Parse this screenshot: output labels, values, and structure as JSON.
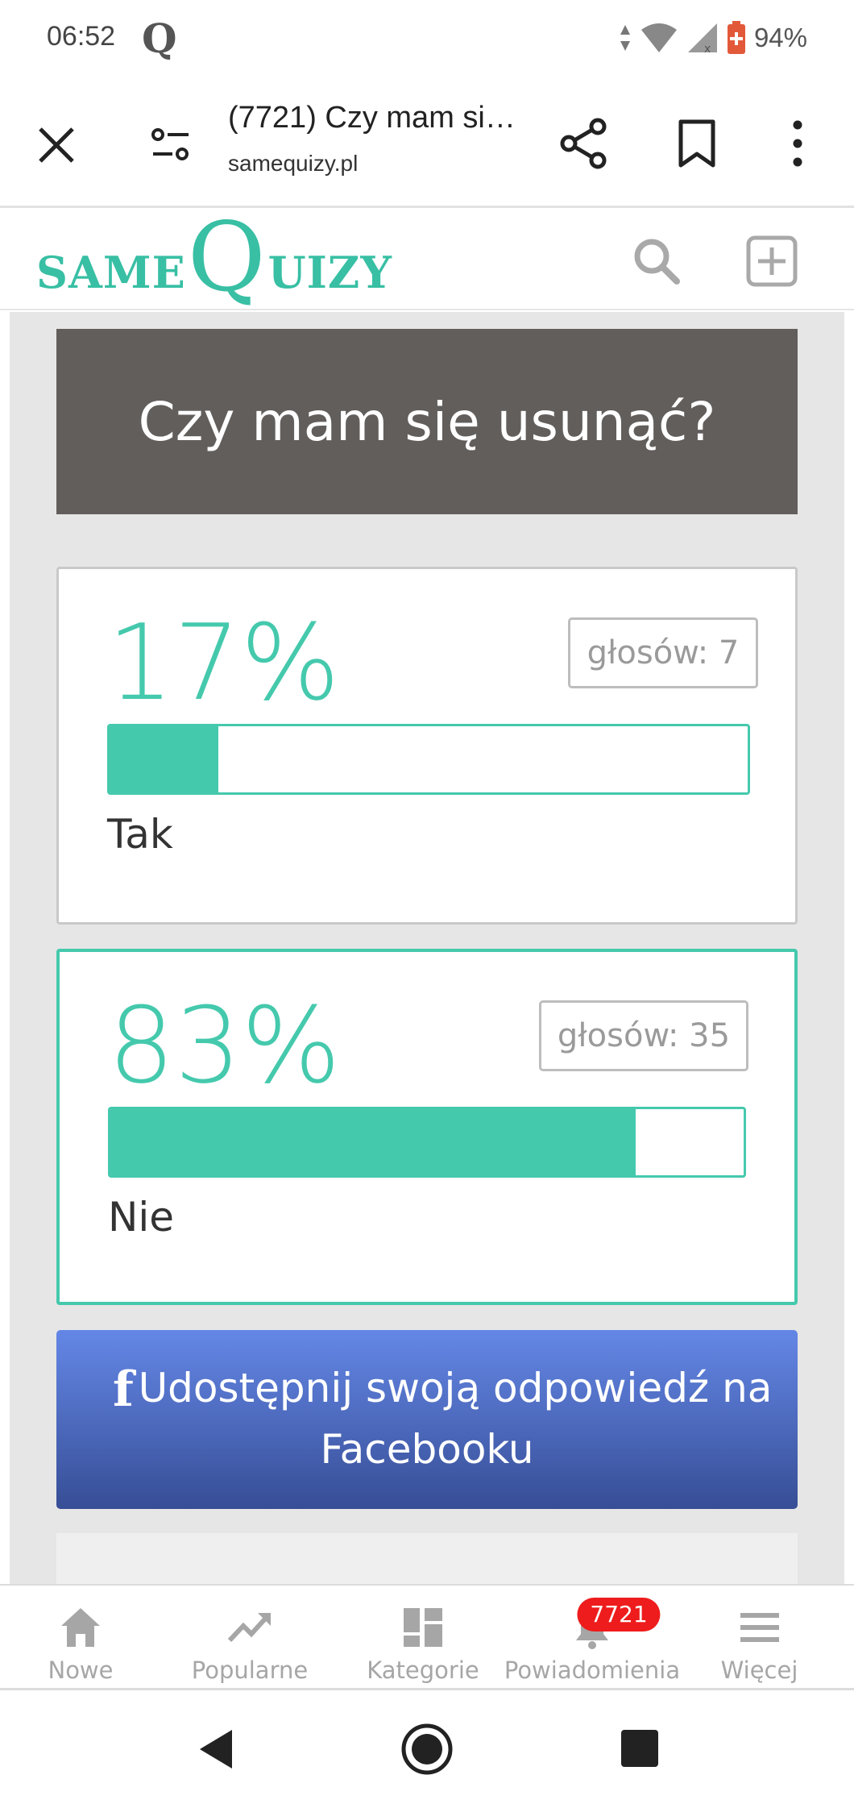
{
  "status_bar": {
    "time": "06:52",
    "notification_icon": "Q",
    "battery": "94%"
  },
  "browser": {
    "page_title": "(7721) Czy mam si…",
    "domain": "samequizy.pl"
  },
  "site": {
    "logo_same": "SAME",
    "logo_q": "Q",
    "logo_uizy": "UIZY"
  },
  "quiz": {
    "title": "Czy mam się usunąć?",
    "answers": [
      {
        "label": "Tak",
        "percent_text": "17%",
        "votes_text": "głosów: 7",
        "share": 0.17,
        "selected": false
      },
      {
        "label": "Nie",
        "percent_text": "83%",
        "votes_text": "głosów: 35",
        "share": 0.83,
        "selected": true
      }
    ],
    "share_button": {
      "icon": "f",
      "line1": "Udostępnij swoją odpowiedź na",
      "line2": "Facebooku"
    }
  },
  "bottom_nav": {
    "items": [
      {
        "label": "Nowe",
        "icon": "home-icon"
      },
      {
        "label": "Popularne",
        "icon": "trending-icon"
      },
      {
        "label": "Kategorie",
        "icon": "categories-icon"
      },
      {
        "label": "Powiadomienia",
        "icon": "bell-icon",
        "badge": "7721"
      },
      {
        "label": "Więcej",
        "icon": "menu-icon"
      }
    ]
  },
  "colors": {
    "accent": "#45c9ad",
    "title_bg": "#625e5c",
    "facebook_top": "#6487e6",
    "facebook_bottom": "#374e96",
    "badge": "#ee1c1c"
  }
}
